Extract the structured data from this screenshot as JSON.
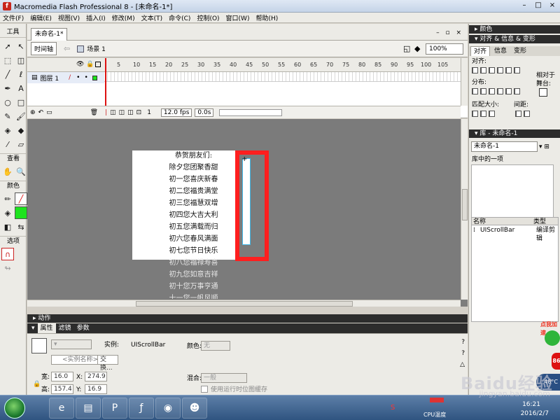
{
  "window": {
    "title": "Macromedia Flash Professional 8 - [未命名-1*]",
    "icon_letter": "f",
    "buttons": [
      "–",
      "□",
      "×"
    ]
  },
  "menu": [
    "文件(F)",
    "编辑(E)",
    "视图(V)",
    "插入(I)",
    "修改(M)",
    "文本(T)",
    "命令(C)",
    "控制(O)",
    "窗口(W)",
    "帮助(H)"
  ],
  "tools": {
    "header": "工具",
    "view_label": "查看",
    "color_label": "颜色",
    "options_label": "选项"
  },
  "document": {
    "tab": "未命名-1*",
    "window_controls": "– ▫ ×",
    "timeline_button": "时间轴",
    "scene": "场景 1",
    "zoom": "100%"
  },
  "timeline": {
    "layer_name": "图层 1",
    "frame_ticks": [
      "5",
      "10",
      "15",
      "20",
      "25",
      "30",
      "35",
      "40",
      "45",
      "50",
      "55",
      "60",
      "65",
      "70",
      "75",
      "80",
      "85",
      "90",
      "95",
      "100",
      "105"
    ],
    "current_frame": "1",
    "fps": "12.0 fps",
    "time": "0.0s"
  },
  "stage": {
    "text_lines": [
      "恭贺朋友们:",
      "除夕您团聚香甜",
      "初一您喜庆新春",
      "初二您福贵满堂",
      "初三您福慧双增",
      "初四您大吉大利",
      "初五您满载而归",
      "初六您春风满面",
      "初七您节日快乐",
      "初八您福禄寿喜",
      "初九您如意吉祥",
      "初十您万事亨通",
      "十一您一帆风顺"
    ]
  },
  "panels": {
    "actions": "动作",
    "properties_tabs": [
      "属性",
      "滤镜",
      "参数"
    ],
    "instance_label": "实例:",
    "instance_value": "UIScrollBar",
    "instance_name_placeholder": "<实例名称>",
    "swap_button": "交换...",
    "color_label": "颜色:",
    "color_value": "无",
    "width_label": "宽:",
    "width_value": "16.0",
    "height_label": "高:",
    "height_value": "157.4",
    "x_label": "X:",
    "x_value": "274.9",
    "y_label": "Y:",
    "y_value": "16.9",
    "blend_label": "混合:",
    "blend_value": "一般",
    "cache_label": "使用运行时位图缓存"
  },
  "right_panels": {
    "color_header": "颜色",
    "align_header": "对齐 & 信息 & 变形",
    "align_tabs": [
      "对齐",
      "信息",
      "变形"
    ],
    "align_label": "对齐:",
    "distribute_label": "分布:",
    "match_size_label": "匹配大小:",
    "spacing_label": "间距:",
    "to_stage_label": "相对于舞台:",
    "library_header": "库 - 未命名-1",
    "library_select": "未命名-1",
    "library_count": "库中的一项",
    "library_cols": [
      "名称",
      "类型"
    ],
    "library_item_name": "UIScrollBar",
    "library_item_type": "编译剪辑"
  },
  "taskbar": {
    "time": "16:21",
    "date": "2016/2/7",
    "cpu_label": "CPU温度",
    "temp": "48°C",
    "promo": "点我加速",
    "count": "86"
  },
  "watermark": {
    "main": "Baidu经验",
    "sub": "jingyan.baidu.com"
  },
  "colors": {
    "highlight_red": "#ff1f1f",
    "scrollbar_cyan": "#3fb7e8",
    "stage_gray": "#7b7b7b",
    "panel_dark": "#2c2c2c"
  }
}
